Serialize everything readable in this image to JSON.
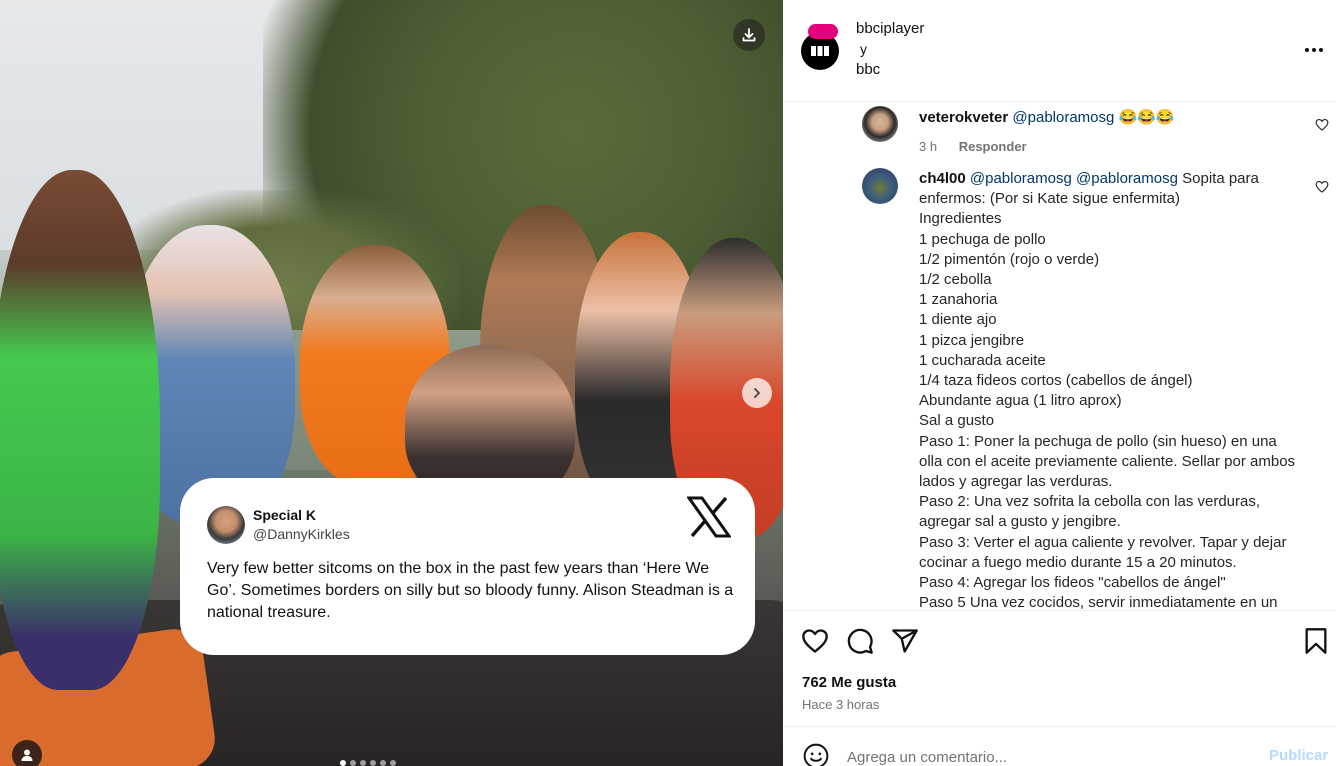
{
  "post": {
    "author": "bbciplayer",
    "conjunction": "y",
    "coauthor": "bbc",
    "likes_count": "762",
    "likes_label": "Me gusta",
    "time_ago": "Hace 3 horas"
  },
  "media": {
    "carousel_dots": 6,
    "active_dot": 0,
    "tweet": {
      "name": "Special K",
      "handle": "@DannyKirkles",
      "text": "Very few better sitcoms on the box in the past few years than ‘Here We Go’. Sometimes borders on silly but so bloody funny. Alison Steadman is a national treasure."
    }
  },
  "comments": [
    {
      "user": "veterokveter",
      "mention": "@pabloramosg",
      "text": "😂😂😂",
      "time": "3 h",
      "reply_label": "Responder"
    },
    {
      "user": "ch4l00",
      "mention1": "@pabloramosg",
      "mention2": "@pabloramosg",
      "lines": [
        "Sopita para enfermos: (Por si Kate sigue enfermita)",
        "Ingredientes",
        "1 pechuga de pollo",
        "1/2 pimentón (rojo o verde)",
        "1/2 cebolla",
        "1 zanahoria",
        "1 diente ajo",
        "1 pizca jengibre",
        "1 cucharada aceite",
        "1/4 taza fideos cortos (cabellos de ángel)",
        "Abundante agua (1 litro aprox)",
        "Sal a gusto",
        "Paso 1: Poner la pechuga de pollo (sin hueso) en una olla con el aceite previamente caliente. Sellar por ambos lados y agregar las verduras.",
        "Paso 2: Una vez sofrita la cebolla con las verduras, agregar sal a gusto y jengibre.",
        "Paso 3: Verter el agua caliente y revolver. Tapar y dejar cocinar a fuego medio durante 15 a 20 minutos.",
        "Paso 4: Agregar los fideos \"cabellos de ángel\"",
        "Paso 5 Una vez cocidos, servir inmediatamente en un"
      ]
    }
  ],
  "composer": {
    "placeholder": "Agrega un comentario...",
    "publish_label": "Publicar"
  },
  "icons": {
    "download": "download-icon",
    "next": "chevron-right-icon",
    "tag": "user-tag-icon",
    "more": "more-horizontal-icon",
    "like": "heart-icon",
    "comment": "comment-icon",
    "share": "send-icon",
    "save": "bookmark-icon",
    "emoji": "emoji-icon",
    "x_logo": "x-logo-icon"
  },
  "colors": {
    "mention": "#00376b",
    "publish_disabled": "#b3dbff",
    "iplayer_pink": "#e6007e"
  }
}
